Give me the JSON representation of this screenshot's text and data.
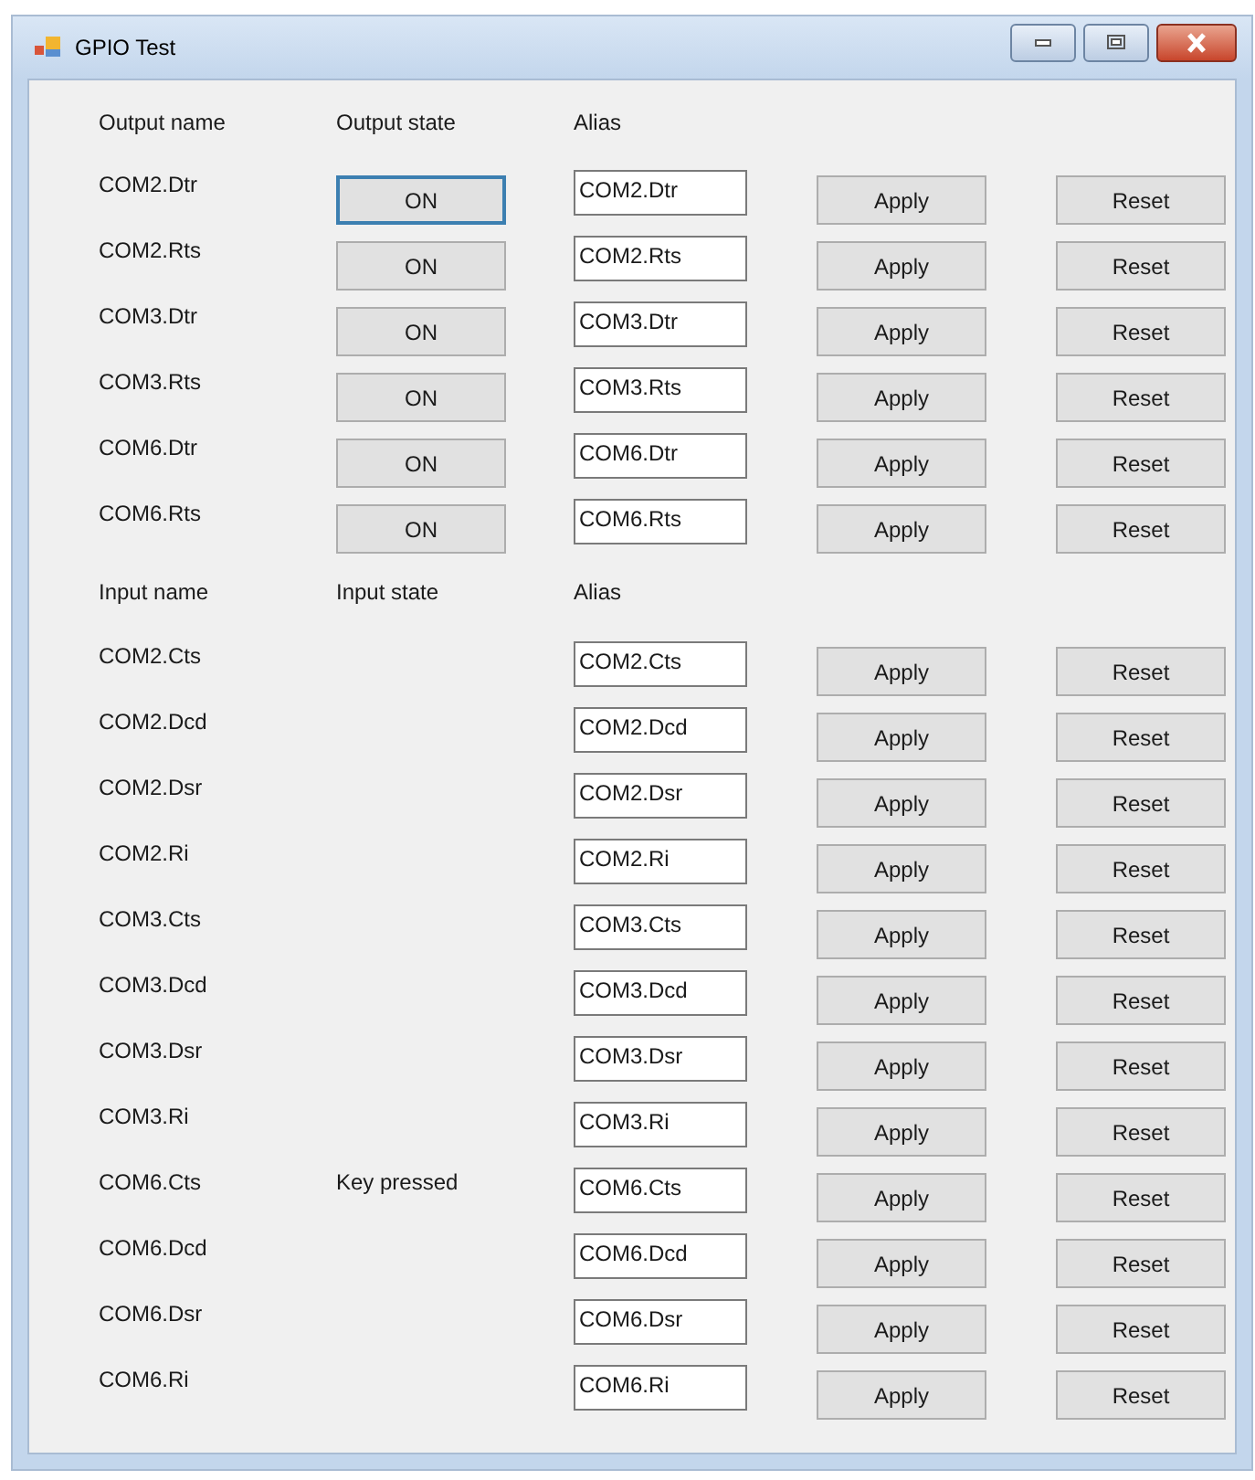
{
  "window": {
    "title": "GPIO Test"
  },
  "output_headers": [
    "Output name",
    "Output state",
    "Alias"
  ],
  "outputs": [
    {
      "name": "COM2.Dtr",
      "state": "ON",
      "alias": "COM2.Dtr",
      "focused": true,
      "apply": "Apply",
      "reset": "Reset"
    },
    {
      "name": "COM2.Rts",
      "state": "ON",
      "alias": "COM2.Rts",
      "focused": false,
      "apply": "Apply",
      "reset": "Reset"
    },
    {
      "name": "COM3.Dtr",
      "state": "ON",
      "alias": "COM3.Dtr",
      "focused": false,
      "apply": "Apply",
      "reset": "Reset"
    },
    {
      "name": "COM3.Rts",
      "state": "ON",
      "alias": "COM3.Rts",
      "focused": false,
      "apply": "Apply",
      "reset": "Reset"
    },
    {
      "name": "COM6.Dtr",
      "state": "ON",
      "alias": "COM6.Dtr",
      "focused": false,
      "apply": "Apply",
      "reset": "Reset"
    },
    {
      "name": "COM6.Rts",
      "state": "ON",
      "alias": "COM6.Rts",
      "focused": false,
      "apply": "Apply",
      "reset": "Reset"
    }
  ],
  "input_headers": [
    "Input name",
    "Input state",
    "Alias"
  ],
  "inputs": [
    {
      "name": "COM2.Cts",
      "alias": "COM2.Cts",
      "apply": "Apply",
      "reset": "Reset"
    },
    {
      "name": "COM2.Dcd",
      "alias": "COM2.Dcd",
      "apply": "Apply",
      "reset": "Reset"
    },
    {
      "name": "COM2.Dsr",
      "alias": "COM2.Dsr",
      "apply": "Apply",
      "reset": "Reset"
    },
    {
      "name": "COM2.Ri",
      "alias": "COM2.Ri",
      "apply": "Apply",
      "reset": "Reset"
    },
    {
      "name": "COM3.Cts",
      "alias": "COM3.Cts",
      "apply": "Apply",
      "reset": "Reset"
    },
    {
      "name": "COM3.Dcd",
      "alias": "COM3.Dcd",
      "apply": "Apply",
      "reset": "Reset"
    },
    {
      "name": "COM3.Dsr",
      "alias": "COM3.Dsr",
      "apply": "Apply",
      "reset": "Reset"
    },
    {
      "name": "COM3.Ri",
      "alias": "COM3.Ri",
      "apply": "Apply",
      "reset": "Reset"
    },
    {
      "name": "COM6.Cts",
      "state": "Key pressed",
      "alias": "COM6.Cts",
      "apply": "Apply",
      "reset": "Reset"
    },
    {
      "name": "COM6.Dcd",
      "alias": "COM6.Dcd",
      "apply": "Apply",
      "reset": "Reset"
    },
    {
      "name": "COM6.Dsr",
      "alias": "COM6.Dsr",
      "apply": "Apply",
      "reset": "Reset"
    },
    {
      "name": "COM6.Ri",
      "alias": "COM6.Ri",
      "apply": "Apply",
      "reset": "Reset"
    }
  ]
}
